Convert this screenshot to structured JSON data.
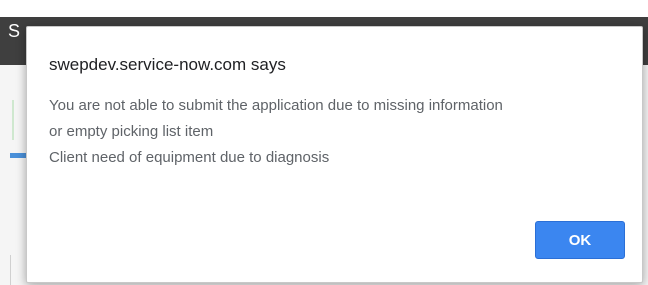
{
  "background": {
    "header_text": "S"
  },
  "dialog": {
    "title": "swepdev.service-now.com says",
    "message_lines": [
      "You are not able to submit the application due to missing information",
      "or empty picking list item",
      "Client need of equipment due to diagnosis"
    ],
    "ok_label": "OK"
  },
  "colors": {
    "button_accent": "#3b86f0",
    "header_background": "#3f3f3f"
  }
}
